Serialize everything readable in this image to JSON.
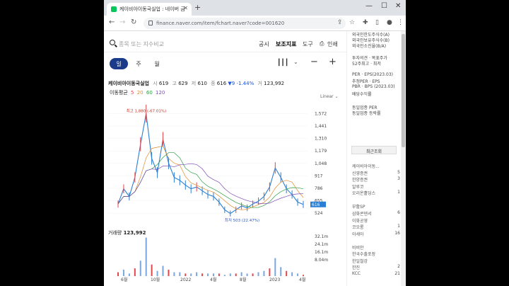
{
  "browser": {
    "tab_title": "케이비아이동국실업 : 네이버 금",
    "url": "finance.naver.com/item/fchart.naver?code=001620"
  },
  "header": {
    "search_placeholder": "종목 또는 지수비교",
    "menu": [
      "공시",
      "보조지표",
      "도구",
      "인쇄"
    ]
  },
  "periods": [
    "일",
    "주",
    "월"
  ],
  "quote": {
    "name": "케이비아이동국실업",
    "open_label": "시",
    "open": "619",
    "high_label": "고",
    "high": "629",
    "low_label": "저",
    "low": "610",
    "close_label": "종",
    "close": "616",
    "change": "▼9",
    "change_pct": "-1.44%",
    "volume_label": "거",
    "volume": "123,992"
  },
  "moving_avg": {
    "label": "이동평균",
    "values": [
      "5",
      "20",
      "60",
      "120"
    ],
    "colors": [
      "#e0474c",
      "#e28a2b",
      "#2f9e44",
      "#7b4bb8"
    ]
  },
  "scale_label": "Linear",
  "chart_data": {
    "type": "line",
    "y_ticks": [
      "1,572",
      "1,441",
      "1,310",
      "1,179",
      "1,048",
      "917",
      "786",
      "655",
      "524"
    ],
    "x_ticks": [
      "6월",
      "10월",
      "2022",
      "4월",
      "8월",
      "2023",
      "4월"
    ],
    "high_annotation": "최고 1,880 (-67.01%)",
    "low_annotation": "최저 503 (22.47%)",
    "current_price_tag": "616",
    "volume_ticks": [
      "32.1m",
      "24.1m",
      "16.1m",
      "8.04m"
    ],
    "volume_label": "거래량",
    "volume_value": "123,992",
    "series": [
      {
        "values": [
          620,
          780,
          700,
          900,
          1250,
          1572,
          1100,
          950,
          1300,
          1050,
          900,
          870,
          820,
          780,
          800,
          760,
          720,
          700,
          640,
          560,
          520,
          560,
          600,
          580,
          620,
          650,
          700,
          800,
          1000,
          900,
          780,
          720,
          640,
          616
        ]
      }
    ]
  },
  "sidebar": {
    "info": [
      "외국인한도주식수(A)",
      "외국인보유주식수(B)",
      "외국인소진율(B/A)",
      "투자의견 · 목표주가",
      "52주최고 · 최저",
      "PER · EPS(2023.03)",
      "추정PER · EPS",
      "PBR · BPS (2023.03)",
      "배당수익률",
      "동일업종 PER",
      "동일업종 등락률"
    ],
    "recent_header": "최근조회",
    "recent": [
      {
        "name": "케이비아이동...",
        "num": ""
      },
      {
        "name": "신영증권",
        "num": "5"
      },
      {
        "name": "한양증권",
        "num": "3"
      },
      {
        "name": "알루코",
        "num": ""
      },
      {
        "name": "오리온홀딩스",
        "num": "1"
      },
      {
        "name": "부활SP",
        "num": ""
      },
      {
        "name": "삼화콘덴서",
        "num": "6"
      },
      {
        "name": "이화공영",
        "num": ""
      },
      {
        "name": "코오롱",
        "num": "1"
      },
      {
        "name": "아세아",
        "num": "16"
      },
      {
        "name": "비비안",
        "num": ""
      },
      {
        "name": "한국수출포장",
        "num": ""
      },
      {
        "name": "한일철강",
        "num": ""
      },
      {
        "name": "한진",
        "num": "2"
      },
      {
        "name": "KCC",
        "num": "21"
      }
    ]
  }
}
